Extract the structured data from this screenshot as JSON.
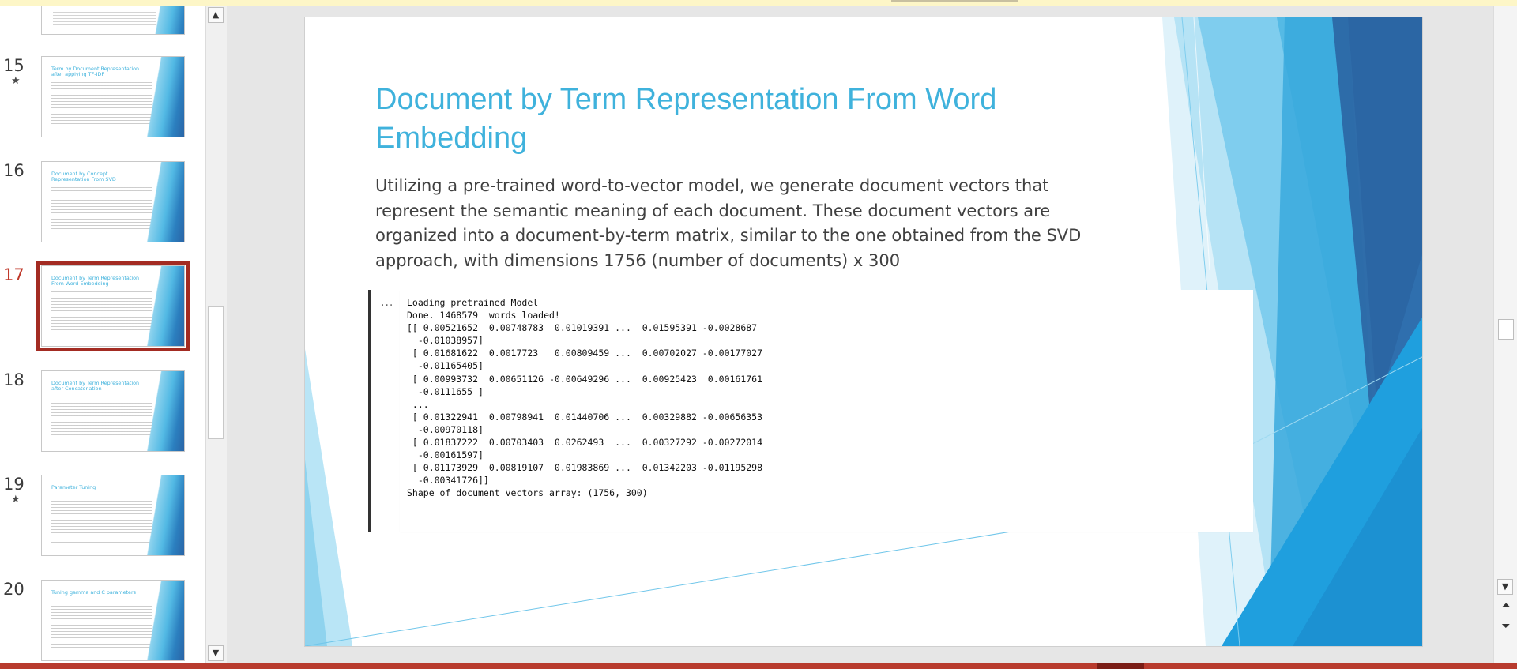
{
  "thumbnails": [
    {
      "number": "15",
      "title": "Term by Document Representation after applying TF-IDF",
      "has_star": true,
      "selected": false
    },
    {
      "number": "16",
      "title": "Document by Concept Representation From SVD",
      "has_star": false,
      "selected": false
    },
    {
      "number": "17",
      "title": "Document by Term Representation From Word Embedding",
      "has_star": false,
      "selected": true
    },
    {
      "number": "18",
      "title": "Document by Term Representation after Concatenation",
      "has_star": false,
      "selected": false
    },
    {
      "number": "19",
      "title": "Parameter Tuning",
      "has_star": true,
      "selected": false
    },
    {
      "number": "20",
      "title": "Tuning gamma and C parameters",
      "has_star": false,
      "selected": false
    }
  ],
  "icons": {
    "star": "animation-star-icon",
    "scroll_up": "scroll-up-icon",
    "scroll_down": "scroll-down-icon",
    "prev_slide": "previous-slide-icon",
    "next_slide": "next-slide-icon"
  },
  "colors": {
    "accent_title": "#3fb2dc",
    "selection": "#a32b22",
    "status_bar": "#b83b2e"
  },
  "slide": {
    "title": "Document by Term Representation From Word Embedding",
    "body": "Utilizing a pre-trained word-to-vector model, we generate document vectors that represent the semantic meaning of each document. These document vectors are organized into a document-by-term matrix, similar to the one obtained from the SVD approach, with dimensions 1756 (number of documents) x 300",
    "output_marker": "...",
    "output_lines": [
      "Loading pretrained Model",
      "Done. 1468579  words loaded!",
      "[[ 0.00521652  0.00748783  0.01019391 ...  0.01595391 -0.0028687",
      "  -0.01038957]",
      " [ 0.01681622  0.0017723   0.00809459 ...  0.00702027 -0.00177027",
      "  -0.01165405]",
      " [ 0.00993732  0.00651126 -0.00649296 ...  0.00925423  0.00161761",
      "  -0.0111655 ]",
      " ...",
      " [ 0.01322941  0.00798941  0.01440706 ...  0.00329882 -0.00656353",
      "  -0.00970118]",
      " [ 0.01837222  0.00703403  0.0262493  ...  0.00327292 -0.00272014",
      "  -0.00161597]",
      " [ 0.01173929  0.00819107  0.01983869 ...  0.01342203 -0.01195298",
      "  -0.00341726]]",
      "Shape of document vectors array: (1756, 300)"
    ]
  }
}
